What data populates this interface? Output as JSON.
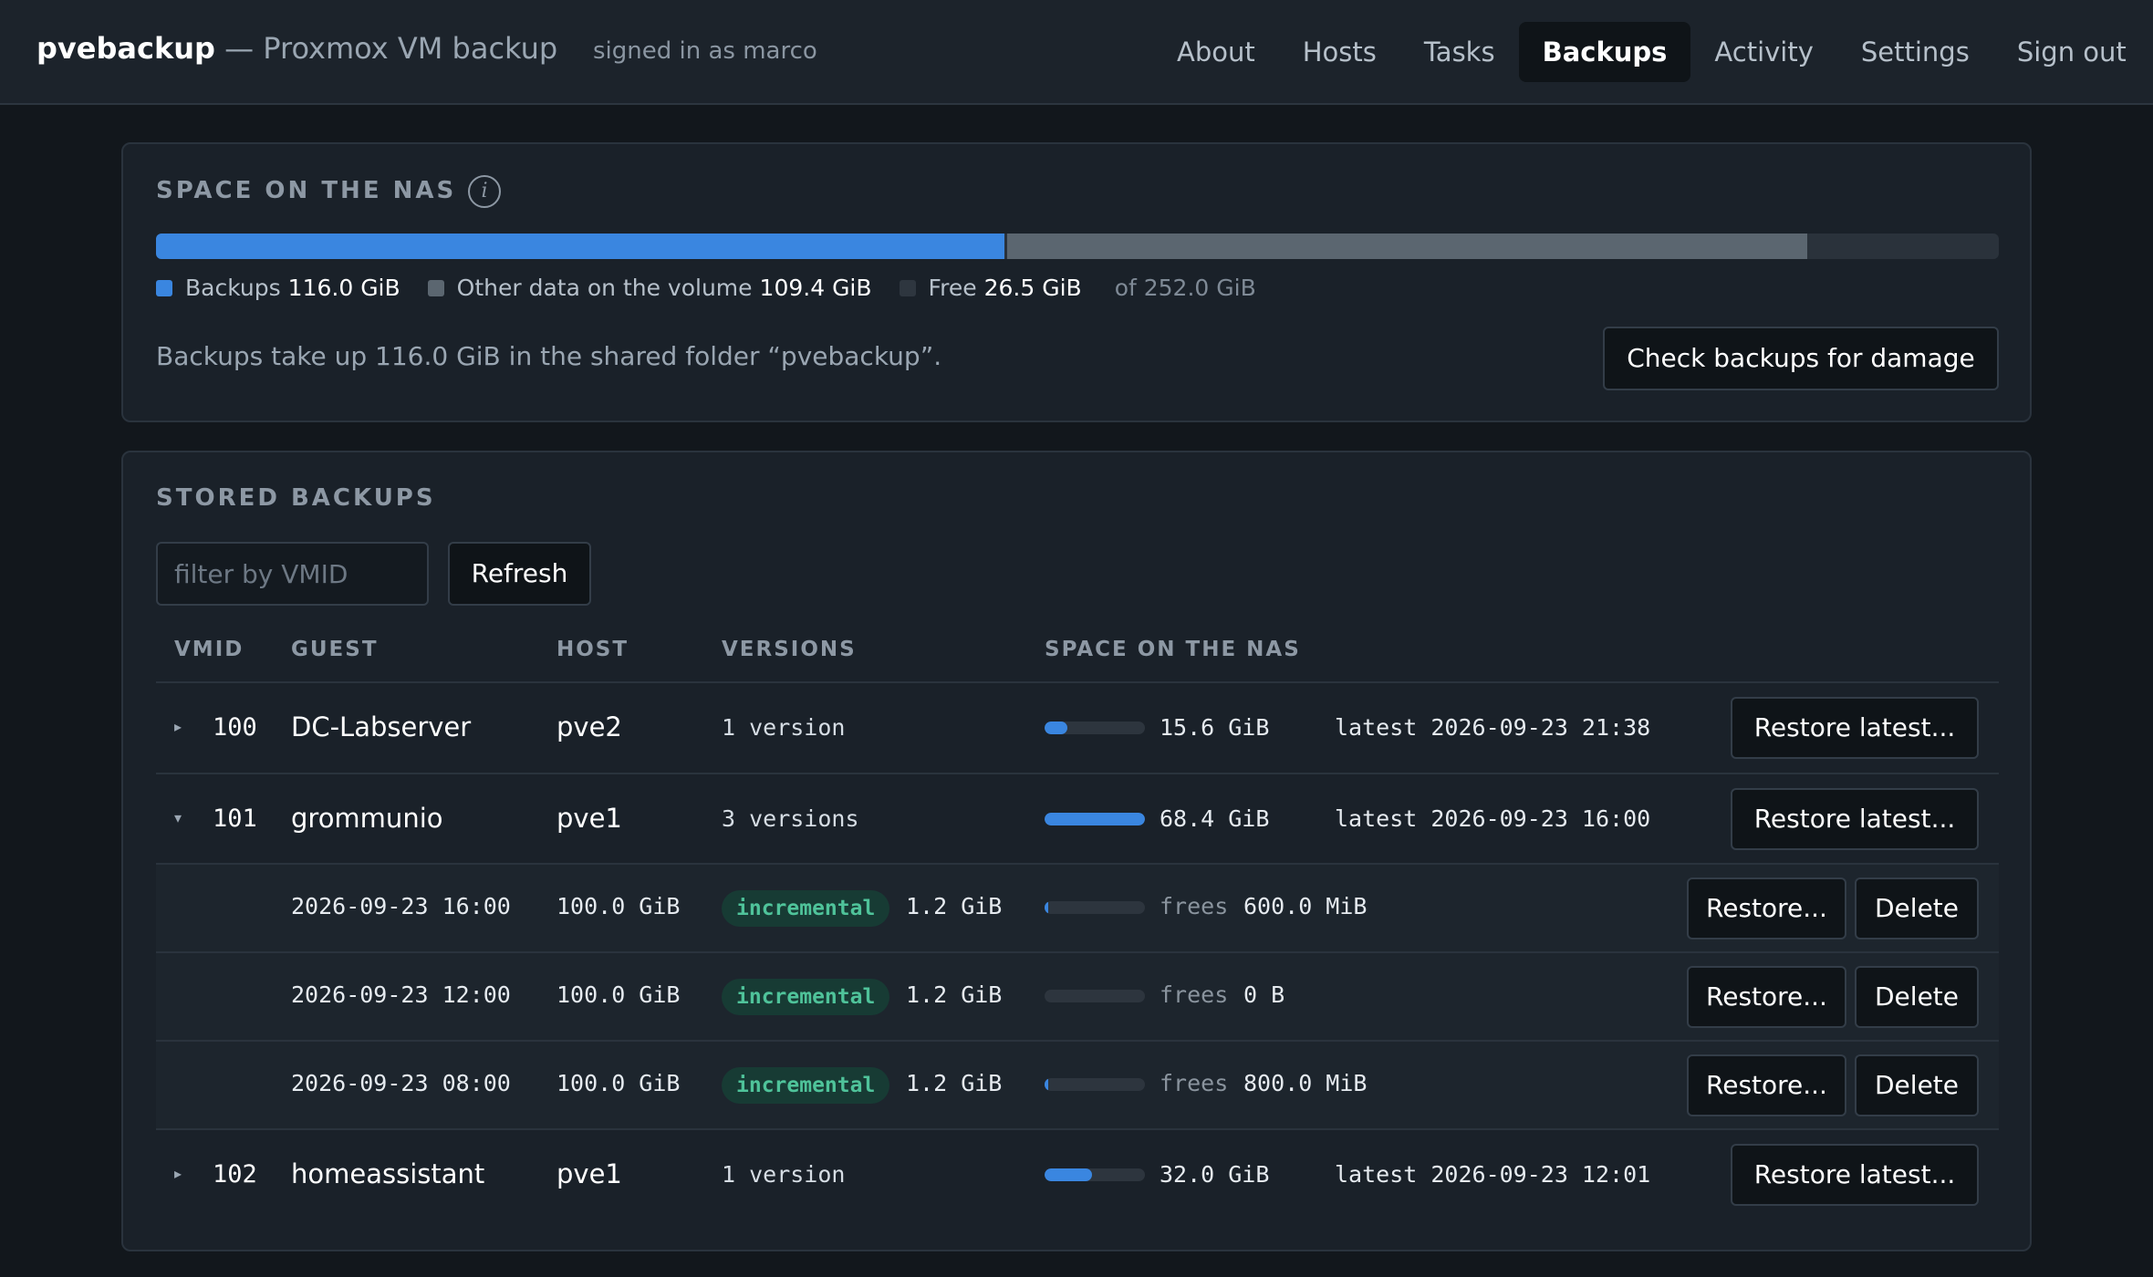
{
  "header": {
    "app_name": "pvebackup",
    "subtitle": "— Proxmox VM backup",
    "signed_in": "signed in as marco",
    "nav": [
      {
        "label": "About",
        "active": false
      },
      {
        "label": "Hosts",
        "active": false
      },
      {
        "label": "Tasks",
        "active": false
      },
      {
        "label": "Backups",
        "active": true
      },
      {
        "label": "Activity",
        "active": false
      },
      {
        "label": "Settings",
        "active": false
      },
      {
        "label": "Sign out",
        "active": false
      }
    ]
  },
  "space": {
    "title": "SPACE ON THE NAS",
    "info_icon": "info-icon",
    "usage": {
      "backups_gib": 116.0,
      "other_gib": 109.4,
      "free_gib": 26.5,
      "total_gib": 252.0
    },
    "legend": {
      "backups_label": "Backups",
      "backups_value": "116.0 GiB",
      "other_label": "Other data on the volume",
      "other_value": "109.4 GiB",
      "free_label": "Free",
      "free_value": "26.5 GiB",
      "total": "of 252.0 GiB"
    },
    "note": "Backups take up 116.0 GiB in the shared folder “pvebackup”.",
    "check_button": "Check backups for damage",
    "colors": {
      "backups": "#3a86e0",
      "other": "#5b6670",
      "free": "#2a323b"
    }
  },
  "backups": {
    "title": "STORED BACKUPS",
    "filter_placeholder": "filter by VMID",
    "refresh_button": "Refresh",
    "columns": {
      "vmid": "VMID",
      "guest": "GUEST",
      "host": "HOST",
      "versions": "VERSIONS",
      "space": "SPACE ON THE NAS"
    },
    "vms": [
      {
        "caret": "▸",
        "expanded": false,
        "vmid": "100",
        "guest": "DC-Labserver",
        "host": "pve2",
        "versions": "1 version",
        "space_fraction": 0.23,
        "size": "15.6 GiB",
        "latest": "latest 2026-09-23 21:38",
        "restore_button": "Restore latest..."
      },
      {
        "caret": "▾",
        "expanded": true,
        "vmid": "101",
        "guest": "grommunio",
        "host": "pve1",
        "versions": "3 versions",
        "space_fraction": 1.0,
        "size": "68.4 GiB",
        "latest": "latest 2026-09-23 16:00",
        "restore_button": "Restore latest...",
        "snapshots": [
          {
            "time": "2026-09-23 16:00",
            "disk": "100.0 GiB",
            "type": "incremental",
            "size": "1.2 GiB",
            "frees_label": "frees",
            "frees": "600.0 MiB",
            "frees_fraction": 0.03,
            "restore_button": "Restore...",
            "delete_button": "Delete"
          },
          {
            "time": "2026-09-23 12:00",
            "disk": "100.0 GiB",
            "type": "incremental",
            "size": "1.2 GiB",
            "frees_label": "frees",
            "frees": "0 B",
            "frees_fraction": 0.0,
            "restore_button": "Restore...",
            "delete_button": "Delete"
          },
          {
            "time": "2026-09-23 08:00",
            "disk": "100.0 GiB",
            "type": "incremental",
            "size": "1.2 GiB",
            "frees_label": "frees",
            "frees": "800.0 MiB",
            "frees_fraction": 0.02,
            "restore_button": "Restore...",
            "delete_button": "Delete"
          }
        ]
      },
      {
        "caret": "▸",
        "expanded": false,
        "vmid": "102",
        "guest": "homeassistant",
        "host": "pve1",
        "versions": "1 version",
        "space_fraction": 0.47,
        "size": "32.0 GiB",
        "latest": "latest 2026-09-23 12:01",
        "restore_button": "Restore latest..."
      }
    ]
  }
}
